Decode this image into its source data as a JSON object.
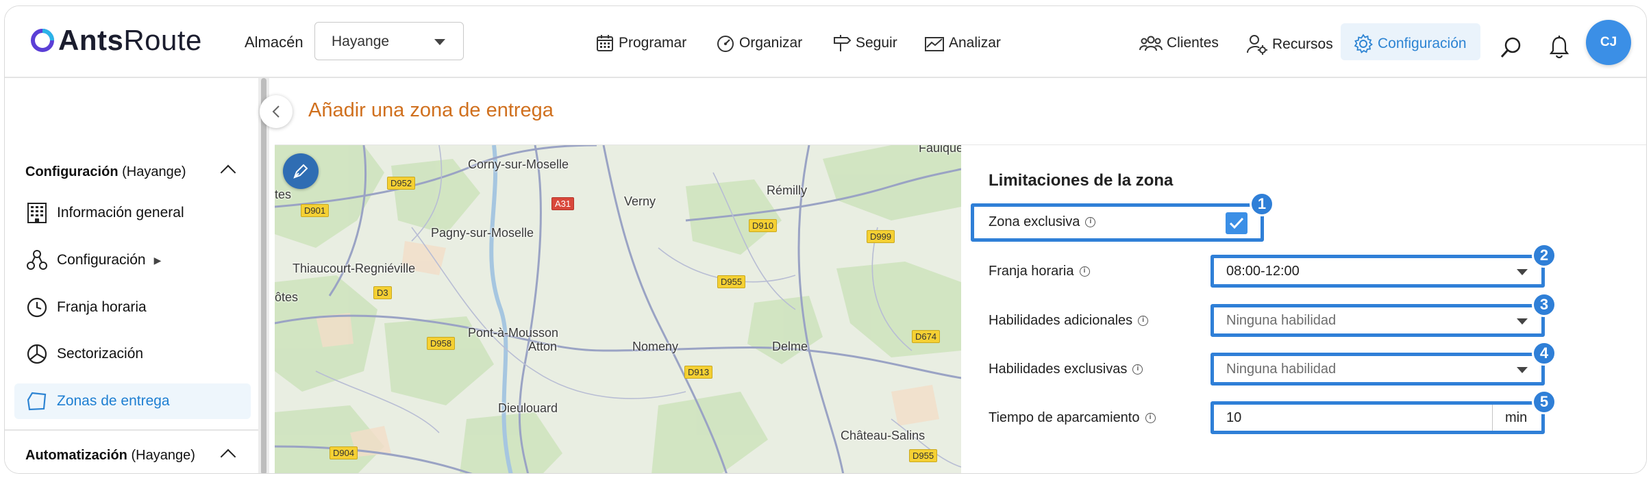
{
  "app": {
    "logo_bold": "Ants",
    "logo_light": "Route"
  },
  "header": {
    "store_label": "Almacén",
    "store_value": "Hayange",
    "nav": {
      "programar": "Programar",
      "organizar": "Organizar",
      "seguir": "Seguir",
      "analizar": "Analizar",
      "clientes": "Clientes",
      "recursos": "Recursos",
      "configuracion": "Configuración"
    },
    "avatar_initials": "CJ",
    "active_nav": "configuracion",
    "accent_color": "#3b8fe6"
  },
  "sidebar": {
    "section1_title": "Configuración",
    "section1_sub": "(Hayange)",
    "items": [
      {
        "label": "Información general",
        "icon": "building-grid-icon"
      },
      {
        "label": "Configuración",
        "icon": "nodes-icon",
        "arrow": "▶"
      },
      {
        "label": "Franja horaria",
        "icon": "clock-icon"
      },
      {
        "label": "Sectorización",
        "icon": "pie-chart-icon"
      },
      {
        "label": "Zonas de entrega",
        "icon": "polygon-icon",
        "active": true
      }
    ],
    "section2_title": "Automatización",
    "section2_sub": "(Hayange)"
  },
  "page": {
    "title": "Añadir una zona de entrega"
  },
  "map": {
    "places": [
      "Corny-sur-Moselle",
      "Verny",
      "Rémilly",
      "Pagny-sur-Moselle",
      "Thiaucourt-Regniéville",
      "Pont-à-Mousson",
      "Atton",
      "Nomeny",
      "Delme",
      "Dieulouard",
      "Château-Salins",
      "Faulque",
      "tes",
      "ôtes"
    ],
    "roads": [
      "D952",
      "D901",
      "A31",
      "D910",
      "D999",
      "D955",
      "D3",
      "D958",
      "D913",
      "D674",
      "D904",
      "D955"
    ]
  },
  "panel": {
    "title": "Limitaciones de la zona",
    "exclusive_label": "Zona exclusiva",
    "exclusive_checked": true,
    "timeslot_label": "Franja horaria",
    "timeslot_value": "08:00-12:00",
    "extra_skills_label": "Habilidades adicionales",
    "extra_skills_placeholder": "Ninguna habilidad",
    "exclusive_skills_label": "Habilidades exclusivas",
    "exclusive_skills_placeholder": "Ninguna habilidad",
    "parking_label": "Tiempo de aparcamiento",
    "parking_value": "10",
    "parking_unit": "min",
    "info_glyph": "i",
    "badges": [
      "1",
      "2",
      "3",
      "4",
      "5"
    ]
  }
}
